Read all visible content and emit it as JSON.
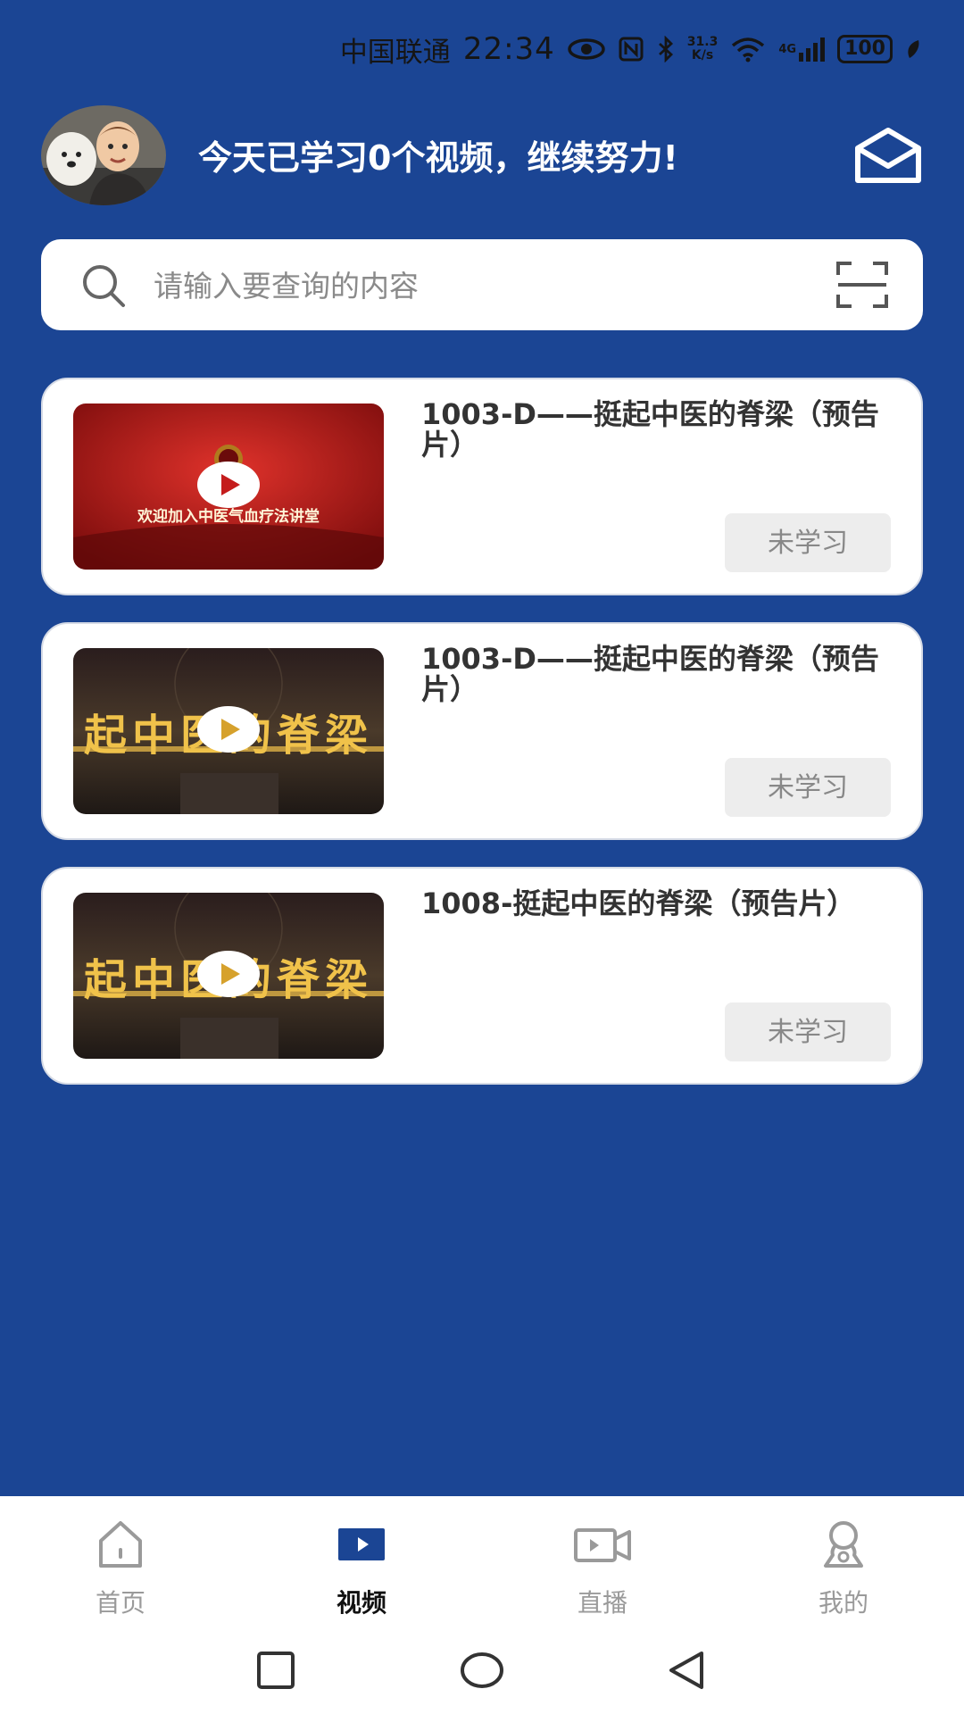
{
  "status_bar": {
    "carrier": "中国联通",
    "time": "22:34",
    "speed_value": "31.3",
    "speed_unit": "K/s",
    "network": "4G",
    "battery": "100"
  },
  "header": {
    "greeting": "今天已学习0个视频，继续努力!"
  },
  "search": {
    "placeholder": "请输入要查询的内容"
  },
  "videos": [
    {
      "title": "1003-D——挺起中医的脊梁（预告片）",
      "thumb_caption": "欢迎加入中医气血疗法讲堂",
      "status": "未学习"
    },
    {
      "title": "1003-D——挺起中医的脊梁（预告片）",
      "thumb_caption": "起中医的脊梁",
      "status": "未学习"
    },
    {
      "title": "1008-挺起中医的脊梁（预告片）",
      "thumb_caption": "起中医的脊梁",
      "status": "未学习"
    }
  ],
  "tabs": [
    {
      "label": "首页",
      "icon": "home-icon"
    },
    {
      "label": "视频",
      "icon": "video-play-icon"
    },
    {
      "label": "直播",
      "icon": "live-camera-icon"
    },
    {
      "label": "我的",
      "icon": "profile-icon"
    }
  ],
  "colors": {
    "background": "#1b4594",
    "active_tab_icon": "#1b4594",
    "inactive": "#9a9a9a",
    "status_button_bg": "#ededed"
  }
}
